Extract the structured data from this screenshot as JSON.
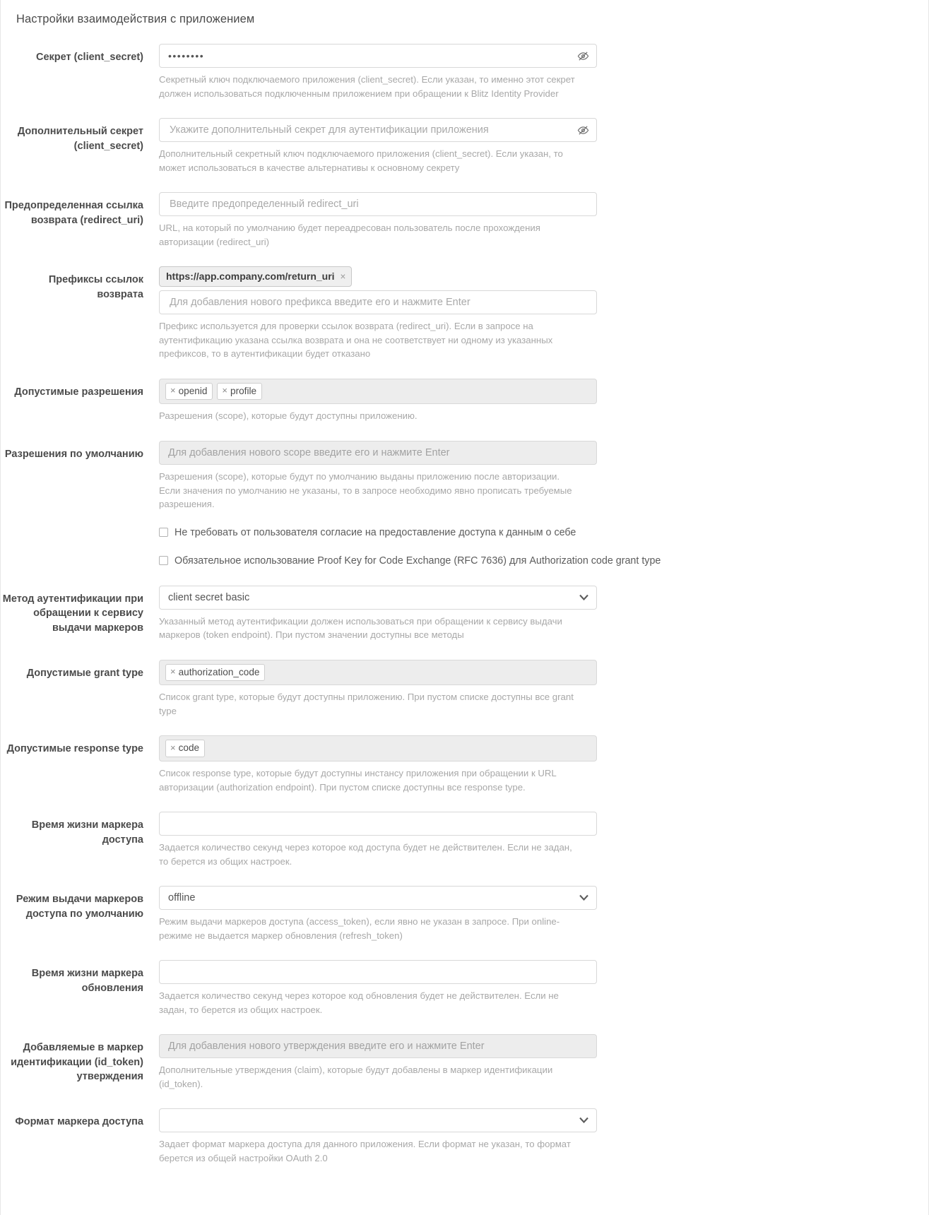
{
  "panel": {
    "title": "Настройки взаимодействия с приложением"
  },
  "fields": {
    "client_secret": {
      "label": "Секрет (client_secret)",
      "value": "••••••••",
      "hint": "Секретный ключ подключаемого приложения (client_secret). Если указан, то именно этот секрет должен использоваться подключенным приложением при обращении к Blitz Identity Provider",
      "icon": "eye-slash-icon"
    },
    "additional_secret": {
      "label": "Дополнительный секрет (client_secret)",
      "placeholder": "Укажите дополнительный секрет для аутентификации приложения",
      "value": "",
      "hint": "Дополнительный секретный ключ подключаемого приложения (client_secret). Если указан, то может использоваться в качестве альтернативы к основному секрету",
      "icon": "eye-slash-icon"
    },
    "redirect_uri": {
      "label": "Предопределенная ссылка возврата (redirect_uri)",
      "placeholder": "Введите предопределенный redirect_uri",
      "value": "",
      "hint": "URL, на который по умолчанию будет переадресован пользователь после прохождения авторизации (redirect_uri)"
    },
    "redirect_prefixes": {
      "label": "Префиксы ссылок возврата",
      "chips": [
        "https://app.company.com/return_uri"
      ],
      "placeholder": "Для добавления нового префикса введите его и нажмите Enter",
      "hint": "Префикс используется для проверки ссылок возврата (redirect_uri). Если в запросе на аутентификацию указана ссылка возврата и она не соответствует ни одному из указанных префиксов, то в аутентификации будет отказано"
    },
    "allowed_scopes": {
      "label": "Допустимые разрешения",
      "tags": [
        "openid",
        "profile"
      ],
      "hint": "Разрешения (scope), которые будут доступны приложению."
    },
    "default_scopes": {
      "label": "Разрешения по умолчанию",
      "placeholder": "Для добавления нового scope введите его и нажмите Enter",
      "tags": [],
      "hint": "Разрешения (scope), которые будут по умолчанию выданы приложению после авторизации. Если значения по умолчанию не указаны, то в запросе необходимо явно прописать требуемые разрешения."
    },
    "no_consent": {
      "label": "Не требовать от пользователя согласие на предоставление доступа к данным о себе",
      "checked": false
    },
    "require_pkce": {
      "label": "Обязательное использование Proof Key for Code Exchange (RFC 7636) для Authorization code grant type",
      "checked": false
    },
    "token_auth_method": {
      "label": "Метод аутентификации при обращении к сервису выдачи маркеров",
      "value": "client secret basic",
      "options": [
        "client secret basic"
      ],
      "hint": "Указанный метод аутентификации должен использоваться при обращении к сервису выдачи маркеров (token endpoint). При пустом значении доступны все методы"
    },
    "grant_types": {
      "label": "Допустимые grant type",
      "tags": [
        "authorization_code"
      ],
      "hint": "Список grant type, которые будут доступны приложению. При пустом списке доступны все grant type"
    },
    "response_types": {
      "label": "Допустимые response type",
      "tags": [
        "code"
      ],
      "hint": "Список response type, которые будут доступны инстансу приложения при обращении к URL авторизации (authorization endpoint). При пустом списке доступны все response type."
    },
    "access_token_ttl": {
      "label": "Время жизни маркера доступа",
      "value": "",
      "hint": "Задается количество секунд через которое код доступа будет не действителен. Если не задан, то берется из общих настроек."
    },
    "access_token_mode": {
      "label": "Режим выдачи маркеров доступа по умолчанию",
      "value": "offline",
      "options": [
        "offline"
      ],
      "hint": "Режим выдачи маркеров доступа (access_token), если явно не указан в запросе. При online-режиме не выдается маркер обновления (refresh_token)"
    },
    "refresh_token_ttl": {
      "label": "Время жизни маркера обновления",
      "value": "",
      "hint": "Задается количество секунд через которое код обновления будет не действителен. Если не задан, то берется из общих настроек."
    },
    "id_token_claims": {
      "label": "Добавляемые в маркер идентификации (id_token) утверждения",
      "placeholder": "Для добавления нового утверждения введите его и нажмите Enter",
      "tags": [],
      "hint": "Дополнительные утверждения (claim), которые будут добавлены в маркер идентификации (id_token)."
    },
    "access_token_format": {
      "label": "Формат маркера доступа",
      "value": "",
      "options": [
        ""
      ],
      "hint": "Задает формат маркера доступа для данного приложения. Если формат не указан, то формат берется из общей настройки OAuth 2.0"
    }
  }
}
